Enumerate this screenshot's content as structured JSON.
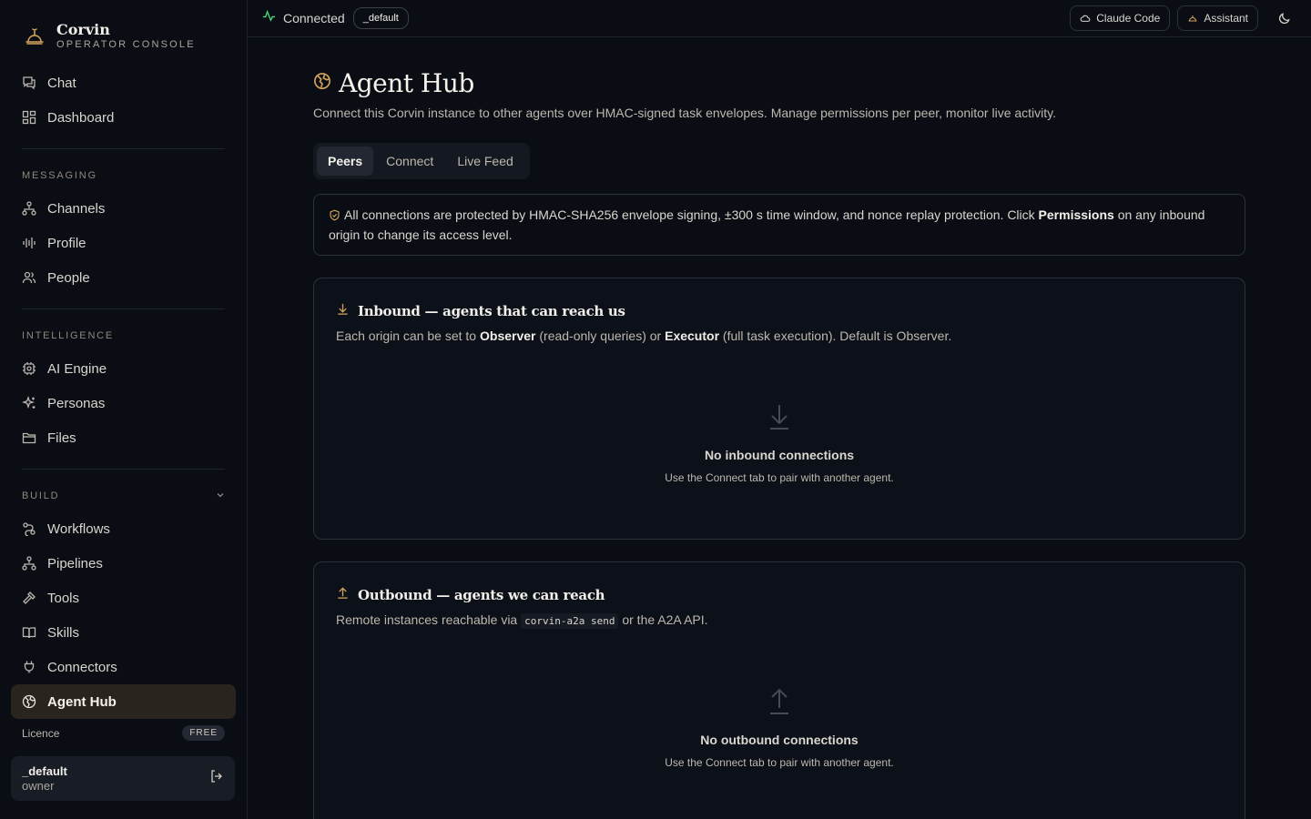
{
  "brand": {
    "name": "Corvin",
    "subtitle": "OPERATOR CONSOLE"
  },
  "sidebar": {
    "top_items": [
      {
        "label": "Chat",
        "icon": "chat-icon"
      },
      {
        "label": "Dashboard",
        "icon": "dashboard-icon"
      }
    ],
    "sections": [
      {
        "title": "MESSAGING",
        "items": [
          {
            "label": "Channels",
            "icon": "channels-icon"
          },
          {
            "label": "Profile",
            "icon": "waveform-icon"
          },
          {
            "label": "People",
            "icon": "people-icon"
          }
        ]
      },
      {
        "title": "INTELLIGENCE",
        "items": [
          {
            "label": "AI Engine",
            "icon": "cpu-icon"
          },
          {
            "label": "Personas",
            "icon": "sparkles-icon"
          },
          {
            "label": "Files",
            "icon": "folder-icon"
          }
        ]
      },
      {
        "title": "BUILD",
        "items": [
          {
            "label": "Workflows",
            "icon": "workflow-icon"
          },
          {
            "label": "Pipelines",
            "icon": "pipeline-icon"
          },
          {
            "label": "Tools",
            "icon": "hammer-icon"
          },
          {
            "label": "Skills",
            "icon": "book-icon"
          },
          {
            "label": "Connectors",
            "icon": "plug-icon"
          },
          {
            "label": "Agent Hub",
            "icon": "globe-icon",
            "active": true
          }
        ]
      }
    ],
    "licence": {
      "label": "Licence",
      "badge": "FREE"
    },
    "user": {
      "name": "_default",
      "role": "owner"
    }
  },
  "topbar": {
    "status": "Connected",
    "profile_pill": "_default",
    "claude_code": "Claude Code",
    "assistant": "Assistant"
  },
  "page": {
    "title": "Agent Hub",
    "description": "Connect this Corvin instance to other agents over HMAC-signed task envelopes. Manage permissions per peer, monitor live activity.",
    "tabs": [
      "Peers",
      "Connect",
      "Live Feed"
    ],
    "active_tab": "Peers",
    "notice": {
      "before": "All connections are protected by HMAC-SHA256 envelope signing, ±300 s time window, and nonce replay protection. Click ",
      "bold": "Permissions",
      "after": " on any inbound origin to change its access level."
    },
    "inbound": {
      "title": "Inbound — agents that can reach us",
      "desc_1": "Each origin can be set to ",
      "observer": "Observer",
      "desc_2": " (read-only queries) or ",
      "executor": "Executor",
      "desc_3": " (full task execution). Default is Observer.",
      "empty_title": "No inbound connections",
      "empty_sub": "Use the Connect tab to pair with another agent."
    },
    "outbound": {
      "title": "Outbound — agents we can reach",
      "desc_1": "Remote instances reachable via ",
      "code": "corvin-a2a send",
      "desc_2": " or the A2A API.",
      "empty_title": "No outbound connections",
      "empty_sub": "Use the Connect tab to pair with another agent."
    }
  },
  "colors": {
    "accent": "#d4a45a",
    "active_bg": "#2a241e",
    "status_green": "#4ade80"
  }
}
